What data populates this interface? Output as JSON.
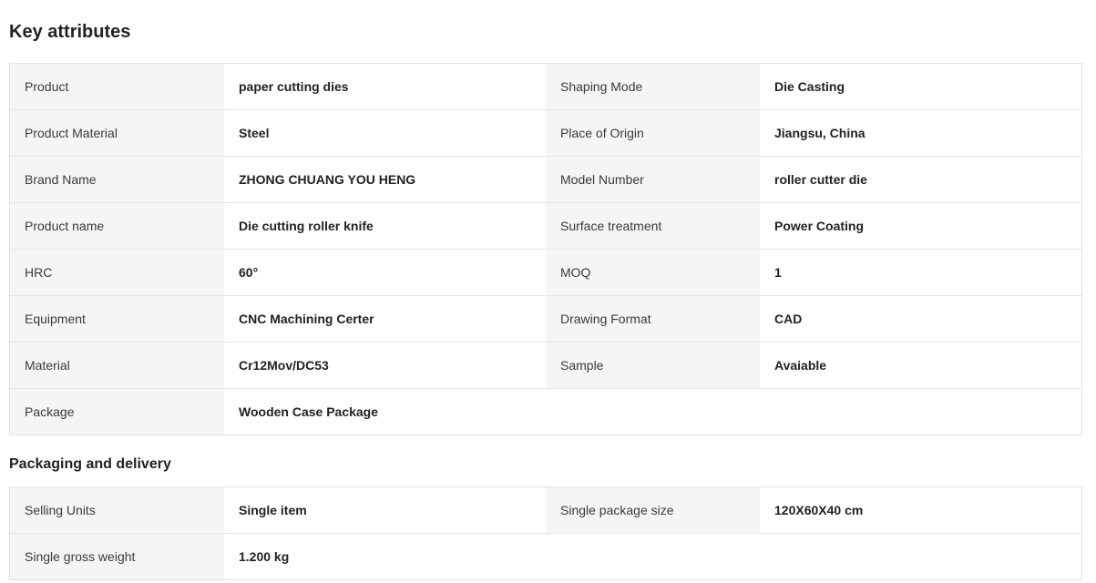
{
  "key_attributes": {
    "title": "Key attributes",
    "rows": [
      {
        "l1": "Product",
        "v1": "paper cutting dies",
        "l2": "Shaping Mode",
        "v2": "Die Casting"
      },
      {
        "l1": "Product Material",
        "v1": "Steel",
        "l2": "Place of Origin",
        "v2": "Jiangsu, China"
      },
      {
        "l1": "Brand Name",
        "v1": "ZHONG CHUANG YOU HENG",
        "l2": "Model Number",
        "v2": "roller cutter die"
      },
      {
        "l1": "Product name",
        "v1": "Die cutting roller knife",
        "l2": "Surface treatment",
        "v2": "Power Coating"
      },
      {
        "l1": "HRC",
        "v1": "60°",
        "l2": "MOQ",
        "v2": "1"
      },
      {
        "l1": "Equipment",
        "v1": "CNC Machining Certer",
        "l2": "Drawing Format",
        "v2": "CAD"
      },
      {
        "l1": "Material",
        "v1": "Cr12Mov/DC53",
        "l2": "Sample",
        "v2": "Avaiable"
      },
      {
        "l1": "Package",
        "v1": "Wooden Case Package"
      }
    ]
  },
  "packaging": {
    "title": "Packaging and delivery",
    "rows": [
      {
        "l1": "Selling Units",
        "v1": "Single item",
        "l2": "Single package size",
        "v2": "120X60X40 cm"
      },
      {
        "l1": "Single gross weight",
        "v1": "1.200 kg"
      }
    ]
  }
}
